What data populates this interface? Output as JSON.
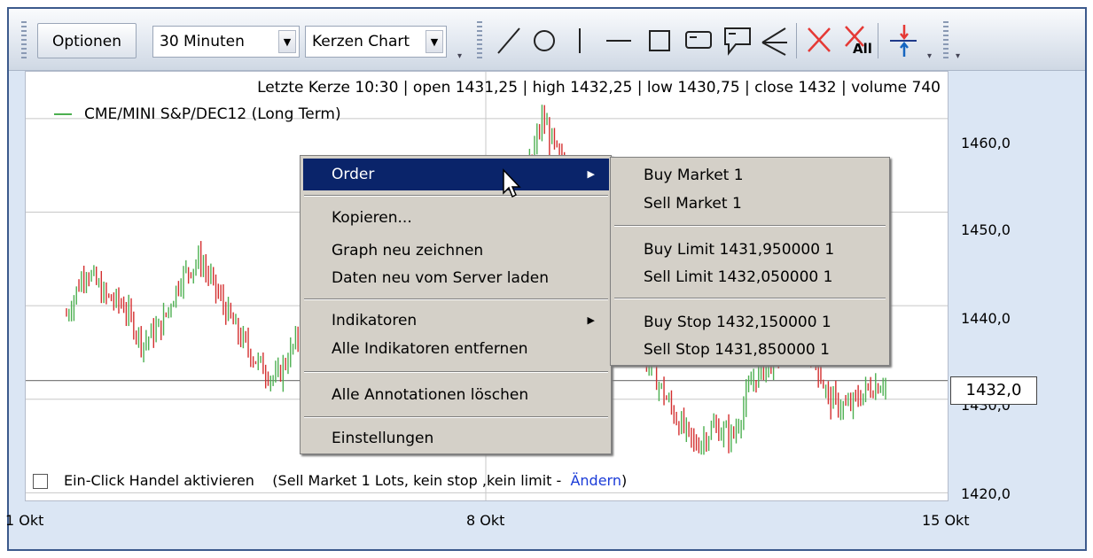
{
  "toolbar": {
    "options_label": "Optionen",
    "interval_value": "30 Minuten",
    "charttype_value": "Kerzen Chart",
    "tools": [
      "line-tool-icon",
      "ellipse-tool-icon",
      "vertical-line-tool-icon",
      "horizontal-line-tool-icon",
      "rectangle-tool-icon",
      "rounded-rectangle-tool-icon",
      "callout-tool-icon",
      "fan-tool-icon",
      "delete-annotation-icon",
      "delete-all-annotations-icon",
      "order-marker-icon"
    ],
    "delete_all_badge": "All"
  },
  "chart": {
    "header": "Letzte Kerze 10:30 | open 1431,25 | high 1432,25 | low 1430,75 | close 1432 | volume 740",
    "legend": "CME/MINI S&P/DEC12 (Long Term)",
    "current_price": "1432,0",
    "one_click_label": "Ein-Click Handel aktivieren",
    "one_click_info": "(Sell Market 1 Lots, kein stop ,kein limit -",
    "one_click_link": "Ändern",
    "one_click_close": ")",
    "colors": {
      "up": "#4caf50",
      "down": "#d32f2f",
      "grid": "#c8c8c8",
      "price_line": "#808080"
    }
  },
  "chart_data": {
    "type": "candlestick",
    "title": "CME/MINI S&P/DEC12 (Long Term)",
    "y_ticks": [
      "1460,0",
      "1450,0",
      "1440,0",
      "1430,0",
      "1420,0"
    ],
    "x_ticks": [
      "1 Okt",
      "8 Okt",
      "15 Okt"
    ],
    "ylim": [
      1419,
      1465
    ],
    "current_price": 1432.0,
    "close_path": [
      1439,
      1444,
      1441,
      1440,
      1436,
      1438,
      1443,
      1445,
      1441,
      1437,
      1434,
      1432,
      1436,
      1437,
      1438,
      1436,
      1439,
      1442,
      1445,
      1443,
      1442,
      1449,
      1451,
      1447,
      1453,
      1460,
      1455,
      1450,
      1446,
      1441,
      1436,
      1432,
      1428,
      1425,
      1427,
      1426,
      1432,
      1434,
      1437,
      1436,
      1430,
      1429,
      1431,
      1432
    ]
  },
  "context_menu": {
    "items": [
      {
        "label": "Order",
        "has_submenu": true
      },
      {
        "label": "Kopieren..."
      },
      {
        "label": "Graph neu zeichnen"
      },
      {
        "label": "Daten neu vom Server laden"
      },
      {
        "label": "Indikatoren",
        "has_submenu": true
      },
      {
        "label": "Alle Indikatoren entfernen"
      },
      {
        "label": "Alle Annotationen löschen"
      },
      {
        "label": "Einstellungen"
      }
    ],
    "submenu_arrow": "▶"
  },
  "order_submenu": {
    "items": [
      "Buy Market 1",
      "Sell Market 1",
      "Buy Limit 1431,950000 1",
      "Sell Limit 1432,050000 1",
      "Buy Stop 1432,150000 1",
      "Sell Stop 1431,850000 1"
    ]
  }
}
